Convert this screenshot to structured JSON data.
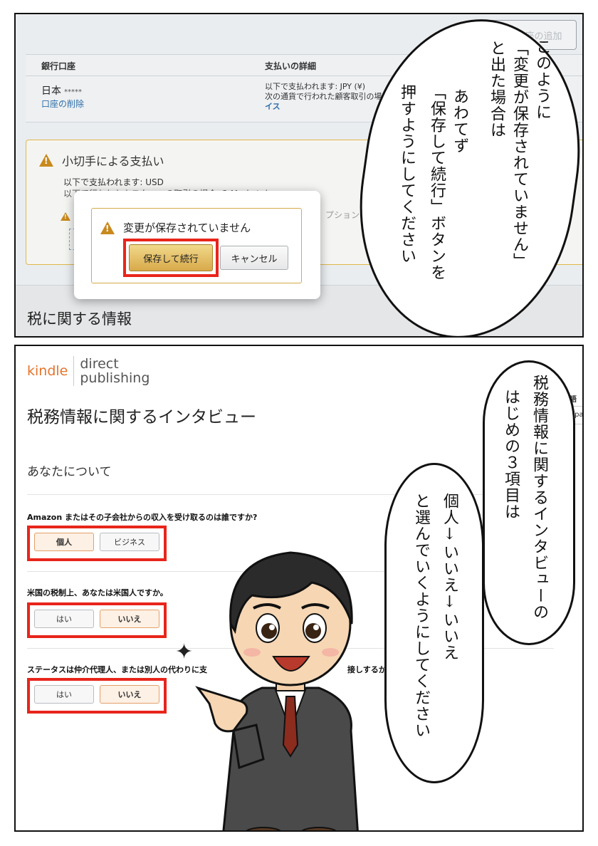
{
  "panel1": {
    "add_bank_button": "銀行口座の追加",
    "table": {
      "col_bank": "銀行口座",
      "col_payment": "支払いの詳細",
      "country": "日本",
      "masked": "*****",
      "delete_link": "口座の削除",
      "detail_line1": "以下で支払われます: JPY (¥)",
      "detail_line2": "次の通貨で行われた顧客取引の場合: すべてのマーケットプレ",
      "detail_line3": "イス"
    },
    "check_section": {
      "title": "小切手による支払い",
      "line1": "以下で支払われます: USD",
      "line2": "以下で行われたカスタマーの取引の場合: 3 Marketplaces",
      "line3": "プションについて詳しくはこちらをご覧ください"
    },
    "tax_heading": "税に関する情報",
    "modal": {
      "message": "変更が保存されていません",
      "save_button": "保存して続行",
      "cancel_button": "キャンセル"
    },
    "bubble": {
      "columns": [
        "このように",
        "「変更が保存されていません」",
        "と出た場合は",
        "あわてず",
        "「保存して続行」ボタンを",
        "押すようにしてください"
      ]
    }
  },
  "panel2": {
    "logo": {
      "kindle": "kindle",
      "direct": "direct",
      "publishing": "publishing"
    },
    "page_title": "税務情報に関するインタビュー",
    "language_label": "言語を",
    "language_value": "Japa",
    "section_title": "あなたについて",
    "questions": [
      {
        "text": "Amazon またはその子会社からの収入を受け取るのは誰ですか?",
        "options": [
          "個人",
          "ビジネス"
        ],
        "selected": "個人"
      },
      {
        "text": "米国の税制上、あなたは米国人ですか。",
        "options": [
          "はい",
          "いいえ"
        ],
        "selected": "いいえ"
      },
      {
        "text": "ステータスは仲介代理人、または別人の代わりに支",
        "options": [
          "はい",
          "いいえ"
        ],
        "selected": "いいえ"
      }
    ],
    "question3_tail": "接しするか",
    "bubble_top": {
      "columns": [
        "税務情報に関するインタビューの",
        "はじめの３項目は"
      ]
    },
    "bubble_bottom": {
      "columns": [
        "個人↓いいえ↓いいえ",
        "と選んでいくようにしてください"
      ]
    }
  },
  "colors": {
    "highlight_red": "#e8251b",
    "kindle_orange": "#e5742b",
    "link_blue": "#2d6ea8",
    "warning_amber": "#c8891d"
  }
}
